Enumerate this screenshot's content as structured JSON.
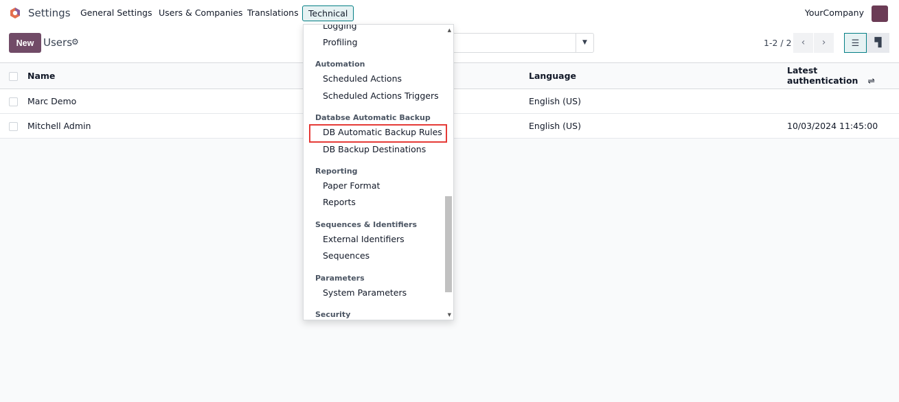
{
  "nav": {
    "brand": "Settings",
    "menus": [
      "General Settings",
      "Users & Companies",
      "Translations",
      "Technical"
    ],
    "company": "YourCompany"
  },
  "control": {
    "new_label": "New",
    "title": "Users",
    "pager": "1-2 / 2"
  },
  "table": {
    "headers": [
      "Name",
      "Language",
      "Latest authentication"
    ],
    "rows": [
      {
        "name": "Marc Demo",
        "language": "English (US)",
        "latest": ""
      },
      {
        "name": "Mitchell Admin",
        "language": "English (US)",
        "latest": "10/03/2024 11:45:00"
      }
    ]
  },
  "dropdown": {
    "top_item": "Logging",
    "profiling": "Profiling",
    "sections": [
      {
        "header": "Automation",
        "items": [
          "Scheduled Actions",
          "Scheduled Actions Triggers"
        ]
      },
      {
        "header": "Databse Automatic Backup",
        "items": [
          "DB Automatic Backup Rules",
          "DB Backup Destinations"
        ]
      },
      {
        "header": "Reporting",
        "items": [
          "Paper Format",
          "Reports"
        ]
      },
      {
        "header": "Sequences & Identifiers",
        "items": [
          "External Identifiers",
          "Sequences"
        ]
      },
      {
        "header": "Parameters",
        "items": [
          "System Parameters"
        ]
      },
      {
        "header": "Security",
        "items": []
      }
    ],
    "highlighted": "DB Automatic Backup Rules"
  },
  "colors": {
    "brand": "#714b67",
    "accent": "#017e84",
    "highlight": "#e53935"
  }
}
